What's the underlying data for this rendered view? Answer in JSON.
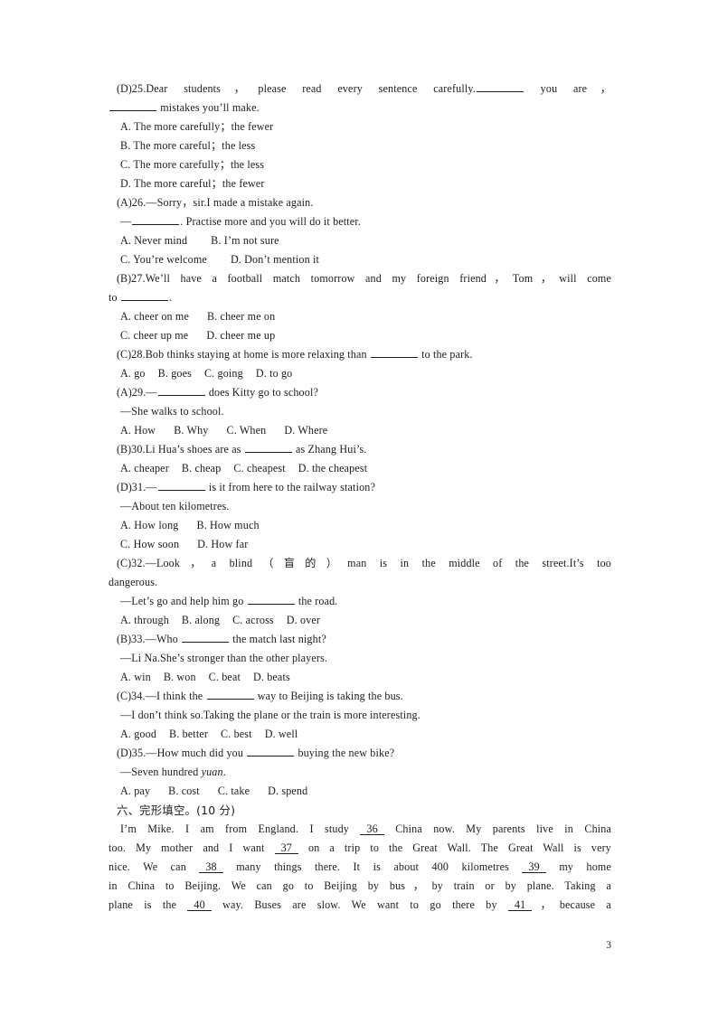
{
  "page": {
    "number": "3",
    "paper_width": 794,
    "paper_height": 1123,
    "background_color": "#ffffff",
    "text_color": "#1c1c1c"
  },
  "questions": [
    {
      "answer_tag": "(D)",
      "number": "25.",
      "stem_part1": "Dear students，please read every sentence carefully.",
      "stem_part2": "you are，",
      "stem_cont": "mistakes you’ll make.",
      "options": [
        "A. The more carefully；the fewer",
        "B. The more careful；the less",
        "C. The more carefully；the less",
        "D. The more careful；the fewer"
      ]
    },
    {
      "answer_tag": "(A)",
      "number": "26.",
      "stem": "—Sorry，sir.I made a mistake again.",
      "reply_prefix": "—",
      "reply_suffix": ". Practise more and you will do it better.",
      "options_row1": [
        "A. Never mind",
        "B. I’m not sure"
      ],
      "options_row2": [
        "C. You’re welcome",
        "D. Don’t mention it"
      ]
    },
    {
      "answer_tag": "(B)",
      "number": "27.",
      "stem": "We’ll have a football match tomorrow and my foreign friend，Tom，will come",
      "stem_cont_prefix": "to",
      "stem_cont_suffix": ".",
      "options_row1": [
        "A. cheer on me",
        "B. cheer me on"
      ],
      "options_row2": [
        "C. cheer up me",
        "D. cheer me up"
      ]
    },
    {
      "answer_tag": "(C)",
      "number": "28.",
      "stem_part1": "Bob thinks staying at home is more relaxing than",
      "stem_part2": "to the park.",
      "options_row1": [
        "A. go",
        "B. goes",
        "C. going",
        "D. to go"
      ]
    },
    {
      "answer_tag": "(A)",
      "number": "29.",
      "stem_prefix": "—",
      "stem_suffix": "does Kitty go to school?",
      "answer_line": "—She walks to school.",
      "options_row1": [
        "A. How",
        "B. Why",
        "C. When",
        "D. Where"
      ]
    },
    {
      "answer_tag": "(B)",
      "number": "30.",
      "stem_part1": "Li Hua’s shoes are as",
      "stem_part2": "as Zhang Hui’s.",
      "options_row1": [
        "A. cheaper",
        "B. cheap",
        "C. cheapest",
        "D. the cheapest"
      ]
    },
    {
      "answer_tag": "(D)",
      "number": "31.",
      "stem_prefix": "—",
      "stem_suffix": "is it from here to the railway station?",
      "answer_line": "—About ten kilometres.",
      "options_row1": [
        "A. How long",
        "B. How much"
      ],
      "options_row2": [
        "C. How soon",
        "D. How far"
      ]
    },
    {
      "answer_tag": "(C)",
      "number": "32.",
      "stem": "—Look，a blind（盲的）man is in the middle of the street.It’s too",
      "stem_cont": "dangerous.",
      "reply_prefix": "—Let’s go and help him go",
      "reply_suffix": "the road.",
      "options_row1": [
        "A. through",
        "B. along",
        "C. across",
        "D. over"
      ]
    },
    {
      "answer_tag": "(B)",
      "number": "33.",
      "stem_prefix": "—Who",
      "stem_suffix": "the match last night?",
      "answer_line": "—Li Na.She’s stronger than the other players.",
      "options_row1": [
        "A. win",
        "B. won",
        "C. beat",
        "D. beats"
      ]
    },
    {
      "answer_tag": "(C)",
      "number": "34.",
      "stem_prefix": "—I think the",
      "stem_suffix": "way to Beijing is taking the bus.",
      "answer_line": "—I don’t think so.Taking the plane or the train is more interesting.",
      "options_row1": [
        "A. good",
        "B. better",
        "C. best",
        "D. well"
      ]
    },
    {
      "answer_tag": "(D)",
      "number": "35.",
      "stem_prefix": "—How much did you",
      "stem_suffix": "buying the new bike?",
      "answer_line_prefix": "—Seven hundred ",
      "answer_line_italic": "yuan",
      "answer_line_suffix": ".",
      "options_row1": [
        "A. pay",
        "B. cost",
        "C. take",
        "D. spend"
      ]
    }
  ],
  "cloze_section": {
    "heading": "六、完形填空。(10 分)",
    "line1_a": "I’m Mike. I am from England. I study",
    "blank36": "36",
    "line1_b": "China now. My parents live in China",
    "line2_a": "too. My mother and I want",
    "blank37": "37",
    "line2_b": "on a trip to the Great Wall. The Great Wall is very",
    "line3_a": "nice. We can",
    "blank38": "38",
    "line3_b": "many things there. It is about 400 kilometres",
    "blank39": "39",
    "line3_c": "my home",
    "line4": "in China to Beijing. We can go to Beijing by bus，by train or by plane. Taking a",
    "line5_a": "plane is the",
    "blank40": "40",
    "line5_b": "way. Buses are slow. We want to go there by",
    "blank41": "41",
    "line5_c": "，because a"
  }
}
